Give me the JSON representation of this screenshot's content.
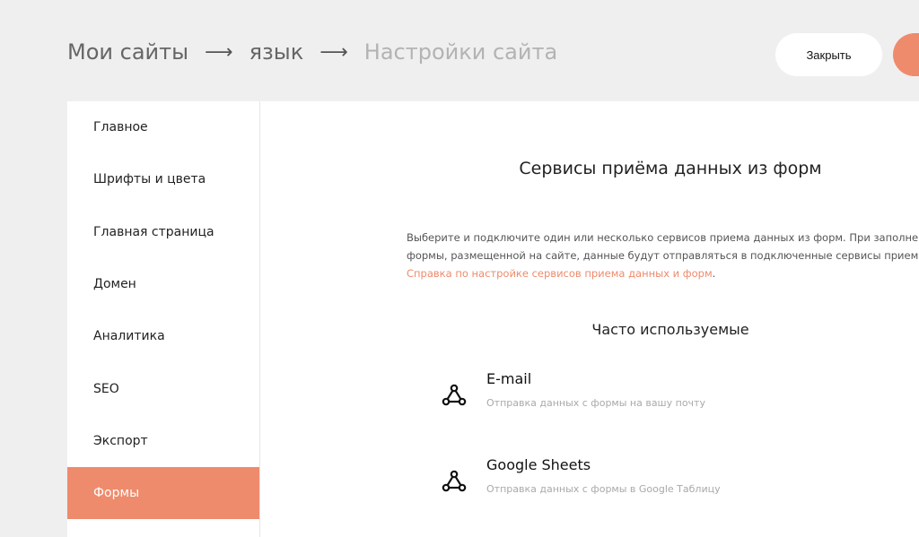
{
  "header": {
    "breadcrumb": [
      "Мои сайты",
      "язык",
      "Настройки сайта"
    ],
    "separator": "⟶",
    "close_label": "Закрыть"
  },
  "sidebar": {
    "items": [
      {
        "label": "Главное"
      },
      {
        "label": "Шрифты и цвета"
      },
      {
        "label": "Главная страница"
      },
      {
        "label": "Домен"
      },
      {
        "label": "Аналитика"
      },
      {
        "label": "SEO"
      },
      {
        "label": "Экспорт"
      },
      {
        "label": "Формы"
      }
    ],
    "active_index": 7
  },
  "main": {
    "title": "Сервисы приёма данных из форм",
    "description_line1": "Выберите и подключите один или несколько сервисов приема данных из форм. При заполнении",
    "description_line2": "формы, размещенной на сайте, данные будут отправляться в подключенные сервисы приема данных.",
    "help_link": "Справка по настройке сервисов приема данных и форм",
    "help_suffix": ".",
    "section_title": "Часто используемые",
    "services": [
      {
        "name": "E-mail",
        "description": "Отправка данных с формы на вашу почту",
        "icon": "webhook-icon"
      },
      {
        "name": "Google Sheets",
        "description": "Отправка данных с формы в Google Таблицу",
        "icon": "webhook-icon"
      }
    ]
  },
  "colors": {
    "accent": "#ee8b6c",
    "background": "#efefef",
    "panel": "#ffffff"
  }
}
